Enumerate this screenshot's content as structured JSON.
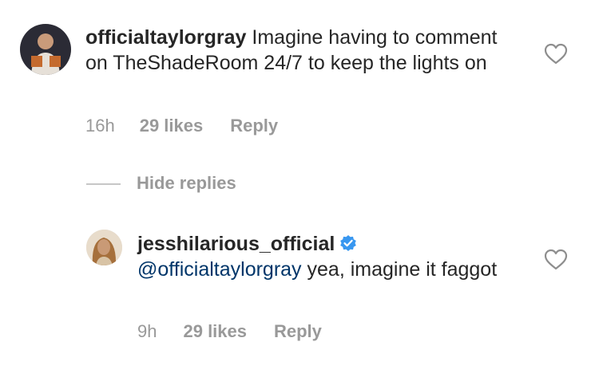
{
  "comment": {
    "username": "officialtaylorgray",
    "text": " Imagine having to comment on TheShadeRoom 24/7 to keep the lights on",
    "time": "16h",
    "likes": "29 likes",
    "reply_label": "Reply"
  },
  "hide_replies_label": "Hide replies",
  "reply": {
    "username": "jesshilarious_official",
    "mention": "@officialtaylorgray",
    "text": " yea, imagine it faggot",
    "time": "9h",
    "likes": "29 likes",
    "reply_label": "Reply"
  },
  "colors": {
    "text": "#262626",
    "meta": "#999999",
    "mention": "#003569",
    "verified": "#3897f0"
  },
  "icons": {
    "like": "heart-outline-icon",
    "verified": "verified-badge-icon"
  }
}
